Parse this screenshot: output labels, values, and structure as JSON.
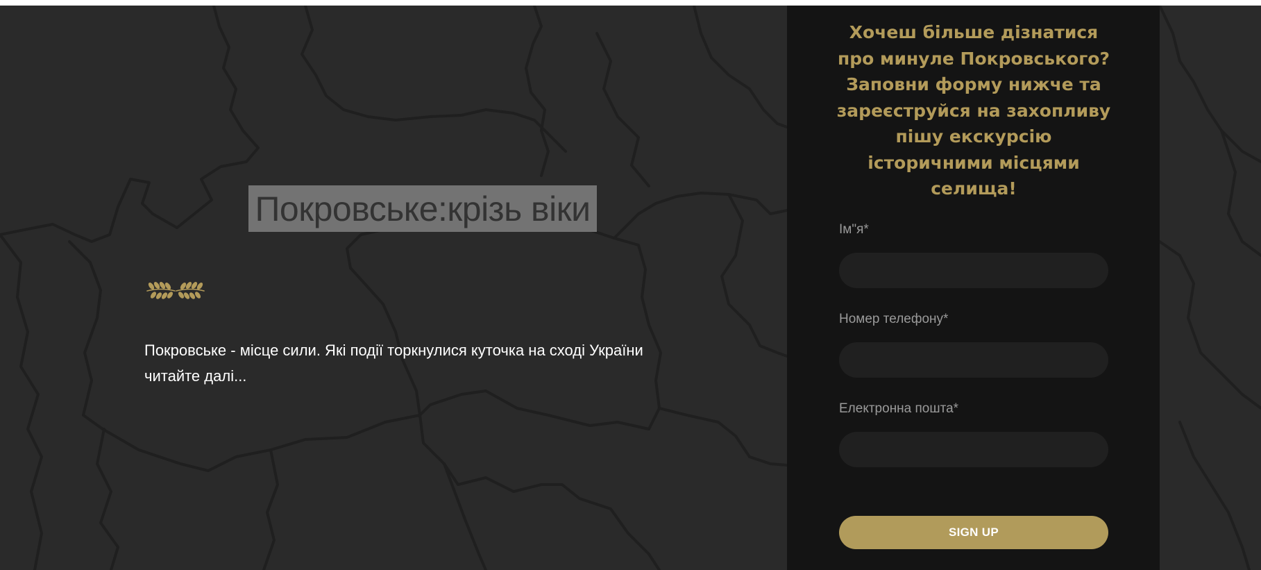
{
  "hero": {
    "title": "Покровське:крізь віки",
    "intro_line1": "Покровське - місце сили. Які події торкнулися куточка на сході України",
    "intro_line2": "читайте далі..."
  },
  "form": {
    "heading": "Хочеш більше дізнатися про минуле Покровського? Заповни форму нижче та зареєструйся на захопливу пішу екскурсію історичними місцями селища!",
    "name_label": "Ім\"я*",
    "name_value": "",
    "phone_label": "Номер телефону*",
    "phone_value": "",
    "email_label": "Електронна пошта*",
    "email_value": "",
    "submit_label": "SIGN UP"
  },
  "icons": {
    "divider": "laurel-branch-icon"
  },
  "colors": {
    "accent_gold": "#b39b5a",
    "button_gold": "#b19b5b",
    "page_bg": "#2a2a2a",
    "panel_bg": "#141414",
    "title_box": "#737373"
  }
}
